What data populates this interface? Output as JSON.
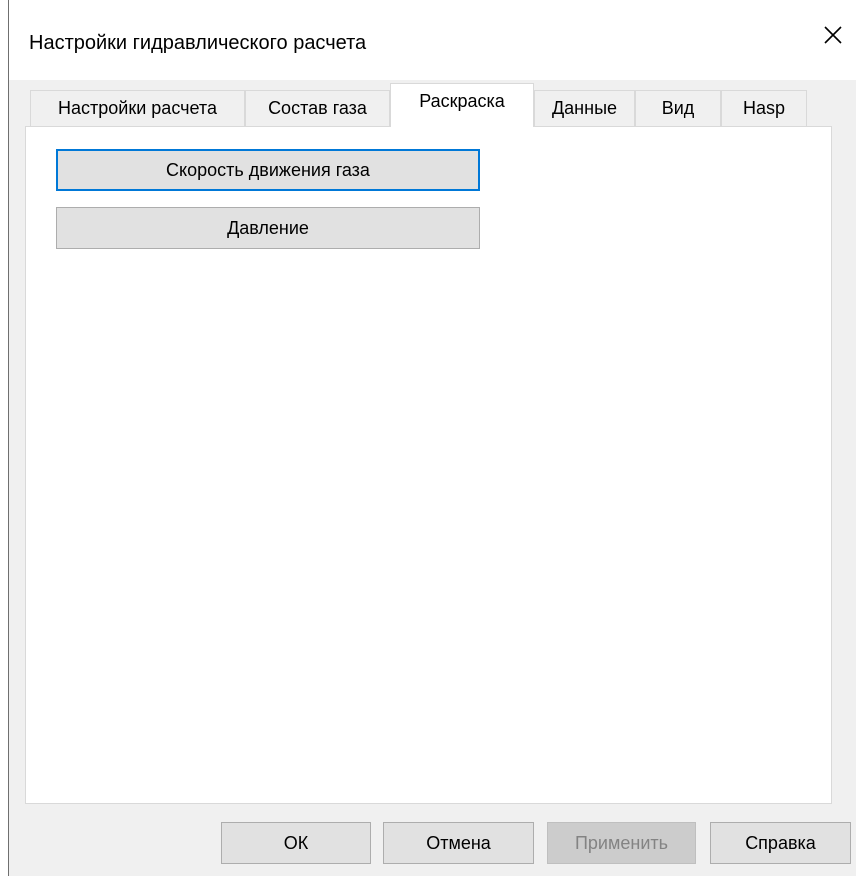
{
  "window": {
    "title": "Настройки гидравлического расчета",
    "close_label": "✕"
  },
  "tabs": [
    {
      "label": "Настройки расчета",
      "active": false
    },
    {
      "label": "Состав газа",
      "active": false
    },
    {
      "label": "Раскраска",
      "active": true
    },
    {
      "label": "Данные",
      "active": false
    },
    {
      "label": "Вид",
      "active": false
    },
    {
      "label": "Hasp",
      "active": false
    }
  ],
  "panel": {
    "buttons": [
      {
        "label": "Скорость движения газа",
        "focused": true
      },
      {
        "label": "Давление",
        "focused": false
      }
    ]
  },
  "footer": {
    "ok_label": "ОК",
    "cancel_label": "Отмена",
    "apply_label": "Применить",
    "apply_enabled": false,
    "help_label": "Справка"
  },
  "colors": {
    "focus_border": "#0078d7",
    "dialog_bg": "#f0f0f0",
    "panel_bg": "#ffffff",
    "disabled_text": "#838383"
  }
}
